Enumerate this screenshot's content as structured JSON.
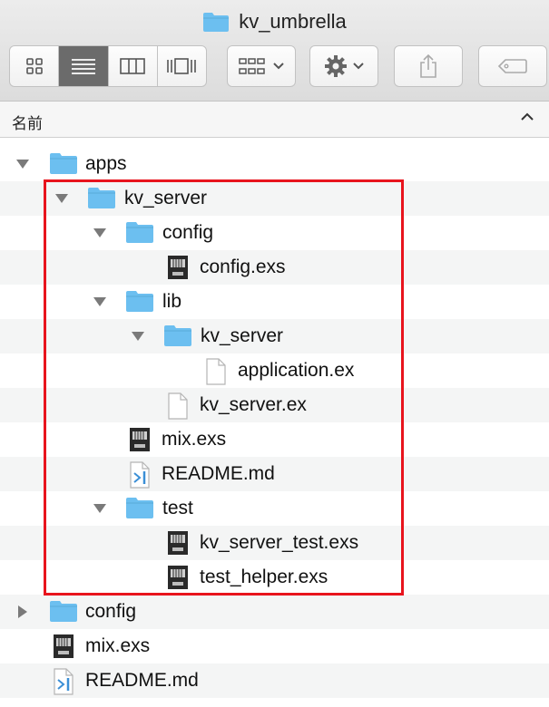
{
  "window": {
    "title": "kv_umbrella",
    "title_icon": "folder-icon"
  },
  "toolbar": {
    "view_buttons": [
      "icon-view-icon",
      "list-view-icon",
      "column-view-icon",
      "coverflow-view-icon"
    ],
    "active_view": "list-view-icon",
    "arrange_icon": "arrange-grid-icon",
    "action_icon": "gear-icon",
    "share_icon": "share-icon",
    "tag_icon": "tag-icon"
  },
  "column_header": {
    "name": "名前",
    "sort_icon": "chevron-up-icon"
  },
  "rows": [
    {
      "label": "apps",
      "type": "folder",
      "expanded": true
    },
    {
      "label": "kv_server",
      "type": "folder",
      "expanded": true
    },
    {
      "label": "config",
      "type": "folder",
      "expanded": true
    },
    {
      "label": "config.exs",
      "type": "exs"
    },
    {
      "label": "lib",
      "type": "folder",
      "expanded": true
    },
    {
      "label": "kv_server",
      "type": "folder",
      "expanded": true
    },
    {
      "label": "application.ex",
      "type": "file"
    },
    {
      "label": "kv_server.ex",
      "type": "file"
    },
    {
      "label": "mix.exs",
      "type": "exs"
    },
    {
      "label": "README.md",
      "type": "vscode"
    },
    {
      "label": "test",
      "type": "folder",
      "expanded": true
    },
    {
      "label": "kv_server_test.exs",
      "type": "exs"
    },
    {
      "label": "test_helper.exs",
      "type": "exs"
    },
    {
      "label": "config",
      "type": "folder",
      "expanded": false
    },
    {
      "label": "mix.exs",
      "type": "exs"
    },
    {
      "label": "README.md",
      "type": "vscode"
    }
  ],
  "colors": {
    "folder": "#6cbff0",
    "highlight": "#e8141d",
    "stripe": "#f4f5f5"
  }
}
